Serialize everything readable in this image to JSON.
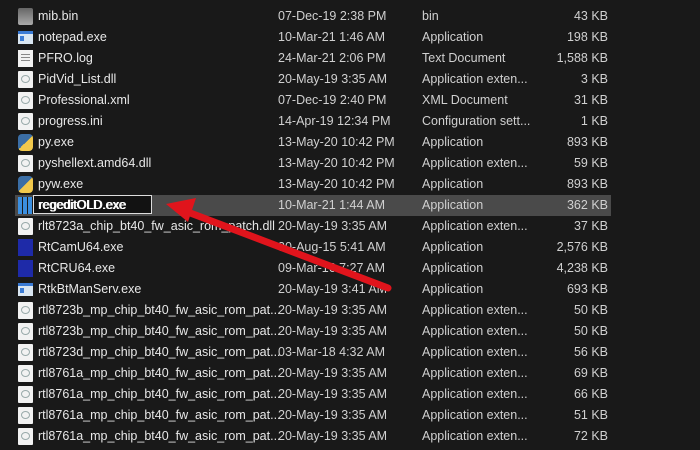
{
  "files": [
    {
      "name": "mib.bin",
      "date": "07-Dec-19 2:38 PM",
      "type": "bin",
      "size": "43 KB",
      "icon": "bin-icon"
    },
    {
      "name": "notepad.exe",
      "date": "10-Mar-21 1:46 AM",
      "type": "Application",
      "size": "198 KB",
      "icon": "app-icon"
    },
    {
      "name": "PFRO.log",
      "date": "24-Mar-21 2:06 PM",
      "type": "Text Document",
      "size": "1,588 KB",
      "icon": "text-icon"
    },
    {
      "name": "PidVid_List.dll",
      "date": "20-May-19 3:35 AM",
      "type": "Application exten...",
      "size": "3 KB",
      "icon": "dll-icon"
    },
    {
      "name": "Professional.xml",
      "date": "07-Dec-19 2:40 PM",
      "type": "XML Document",
      "size": "31 KB",
      "icon": "xml-icon"
    },
    {
      "name": "progress.ini",
      "date": "14-Apr-19 12:34 PM",
      "type": "Configuration sett...",
      "size": "1 KB",
      "icon": "ini-icon"
    },
    {
      "name": "py.exe",
      "date": "13-May-20 10:42 PM",
      "type": "Application",
      "size": "893 KB",
      "icon": "python-icon"
    },
    {
      "name": "pyshellext.amd64.dll",
      "date": "13-May-20 10:42 PM",
      "type": "Application exten...",
      "size": "59 KB",
      "icon": "dll-icon"
    },
    {
      "name": "pyw.exe",
      "date": "13-May-20 10:42 PM",
      "type": "Application",
      "size": "893 KB",
      "icon": "python-icon"
    },
    {
      "name": "regeditOLD.exe",
      "date": "10-Mar-21 1:44 AM",
      "type": "Application",
      "size": "362 KB",
      "icon": "regedit-icon",
      "selected": true,
      "renaming": true
    },
    {
      "name": "rlt8723a_chip_bt40_fw_asic_rom_patch.dll",
      "date": "20-May-19 3:35 AM",
      "type": "Application exten...",
      "size": "37 KB",
      "icon": "dll-icon"
    },
    {
      "name": "RtCamU64.exe",
      "date": "30-Aug-15 5:41 AM",
      "type": "Application",
      "size": "2,576 KB",
      "icon": "realtek-icon"
    },
    {
      "name": "RtCRU64.exe",
      "date": "09-Mar-16 7:27 AM",
      "type": "Application",
      "size": "4,238 KB",
      "icon": "realtek-icon"
    },
    {
      "name": "RtkBtManServ.exe",
      "date": "20-May-19 3:41 AM",
      "type": "Application",
      "size": "693 KB",
      "icon": "app-icon"
    },
    {
      "name": "rtl8723b_mp_chip_bt40_fw_asic_rom_pat...",
      "date": "20-May-19 3:35 AM",
      "type": "Application exten...",
      "size": "50 KB",
      "icon": "dll-icon"
    },
    {
      "name": "rtl8723b_mp_chip_bt40_fw_asic_rom_pat...",
      "date": "20-May-19 3:35 AM",
      "type": "Application exten...",
      "size": "50 KB",
      "icon": "dll-icon"
    },
    {
      "name": "rtl8723d_mp_chip_bt40_fw_asic_rom_pat...",
      "date": "03-Mar-18 4:32 AM",
      "type": "Application exten...",
      "size": "56 KB",
      "icon": "dll-icon"
    },
    {
      "name": "rtl8761a_mp_chip_bt40_fw_asic_rom_pat...",
      "date": "20-May-19 3:35 AM",
      "type": "Application exten...",
      "size": "69 KB",
      "icon": "dll-icon"
    },
    {
      "name": "rtl8761a_mp_chip_bt40_fw_asic_rom_pat...",
      "date": "20-May-19 3:35 AM",
      "type": "Application exten...",
      "size": "66 KB",
      "icon": "dll-icon"
    },
    {
      "name": "rtl8761a_mp_chip_bt40_fw_asic_rom_pat...",
      "date": "20-May-19 3:35 AM",
      "type": "Application exten...",
      "size": "51 KB",
      "icon": "dll-icon"
    },
    {
      "name": "rtl8761a_mp_chip_bt40_fw_asic_rom_pat...",
      "date": "20-May-19 3:35 AM",
      "type": "Application exten...",
      "size": "72 KB",
      "icon": "dll-icon"
    }
  ],
  "rename_value": "regeditOLD.exe",
  "colors": {
    "background": "#191919",
    "selected_row": "#4a4a4a",
    "arrow": "#e0141c"
  }
}
